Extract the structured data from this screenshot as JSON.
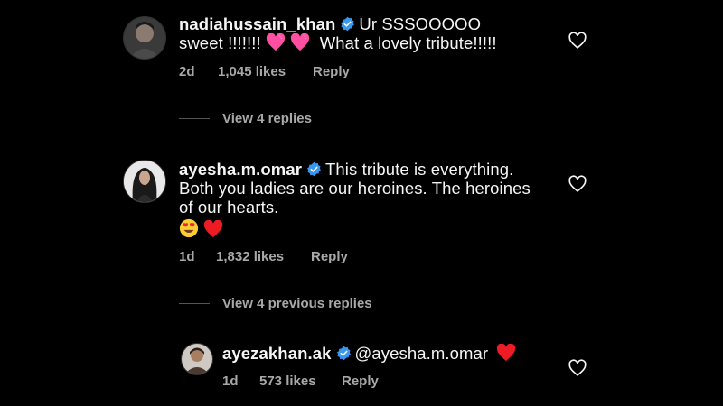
{
  "comments": [
    {
      "username": "nadiahussain_khan",
      "text_line1": "Ur SSSOOOOO",
      "text_line2a": "sweet !!!!!!!",
      "text_line2b": "What a lovely tribute!!!!!",
      "time": "2d",
      "likes": "1,045 likes",
      "reply": "Reply"
    },
    {
      "username": "ayesha.m.omar",
      "text_line1": "This tribute is everything.",
      "text_line2": "Both you ladies are our heroines. The heroines",
      "text_line3": "of our hearts.",
      "time": "1d",
      "likes": "1,832 likes",
      "reply": "Reply"
    },
    {
      "username": "ayezakhan.ak",
      "text": "@ayesha.m.omar",
      "time": "1d",
      "likes": "573 likes",
      "reply": "Reply"
    }
  ],
  "view_replies_1": "View 4 replies",
  "view_replies_2": "View 4 previous replies",
  "colors": {
    "background": "#000000",
    "text": "#f5f5f5",
    "muted": "#a8a8a8",
    "verified": "#3897f0",
    "heart_red": "#ed1c24",
    "heart_pink": "#ff4fa3"
  },
  "icons": [
    "verified-badge-icon",
    "heart-outline-icon",
    "pink-heart-emoji",
    "heart-eyes-emoji",
    "red-heart-emoji"
  ]
}
